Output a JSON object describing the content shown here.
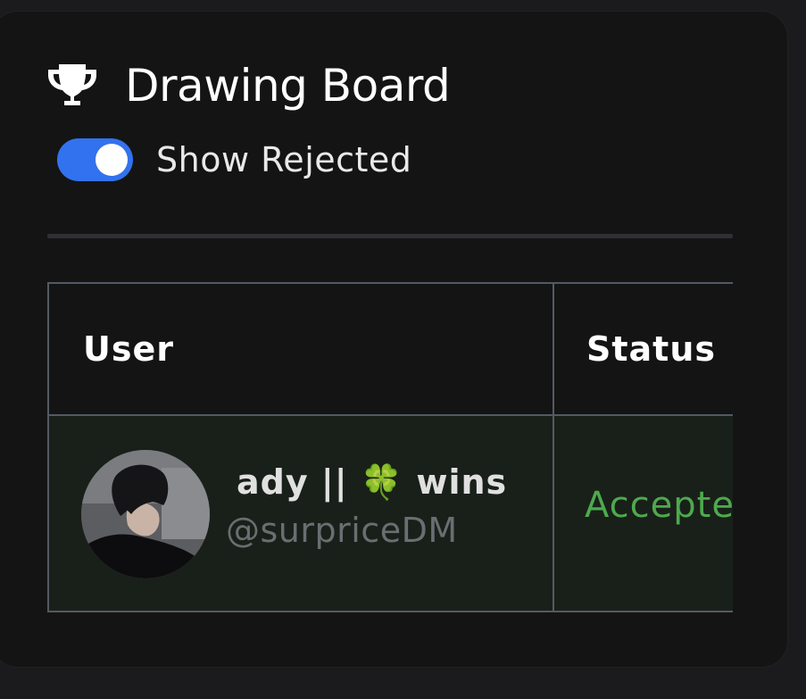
{
  "panel": {
    "title": "Drawing Board",
    "icon": "trophy-icon"
  },
  "toggle": {
    "label": "Show Rejected",
    "checked": true,
    "accent_color": "#3272ee"
  },
  "table": {
    "columns": [
      "User",
      "Status"
    ],
    "rows": [
      {
        "name": "ady || 🍀 wins",
        "handle": "@surpriceDM",
        "status": "Accepted",
        "status_color": "#4ea94e"
      }
    ]
  }
}
